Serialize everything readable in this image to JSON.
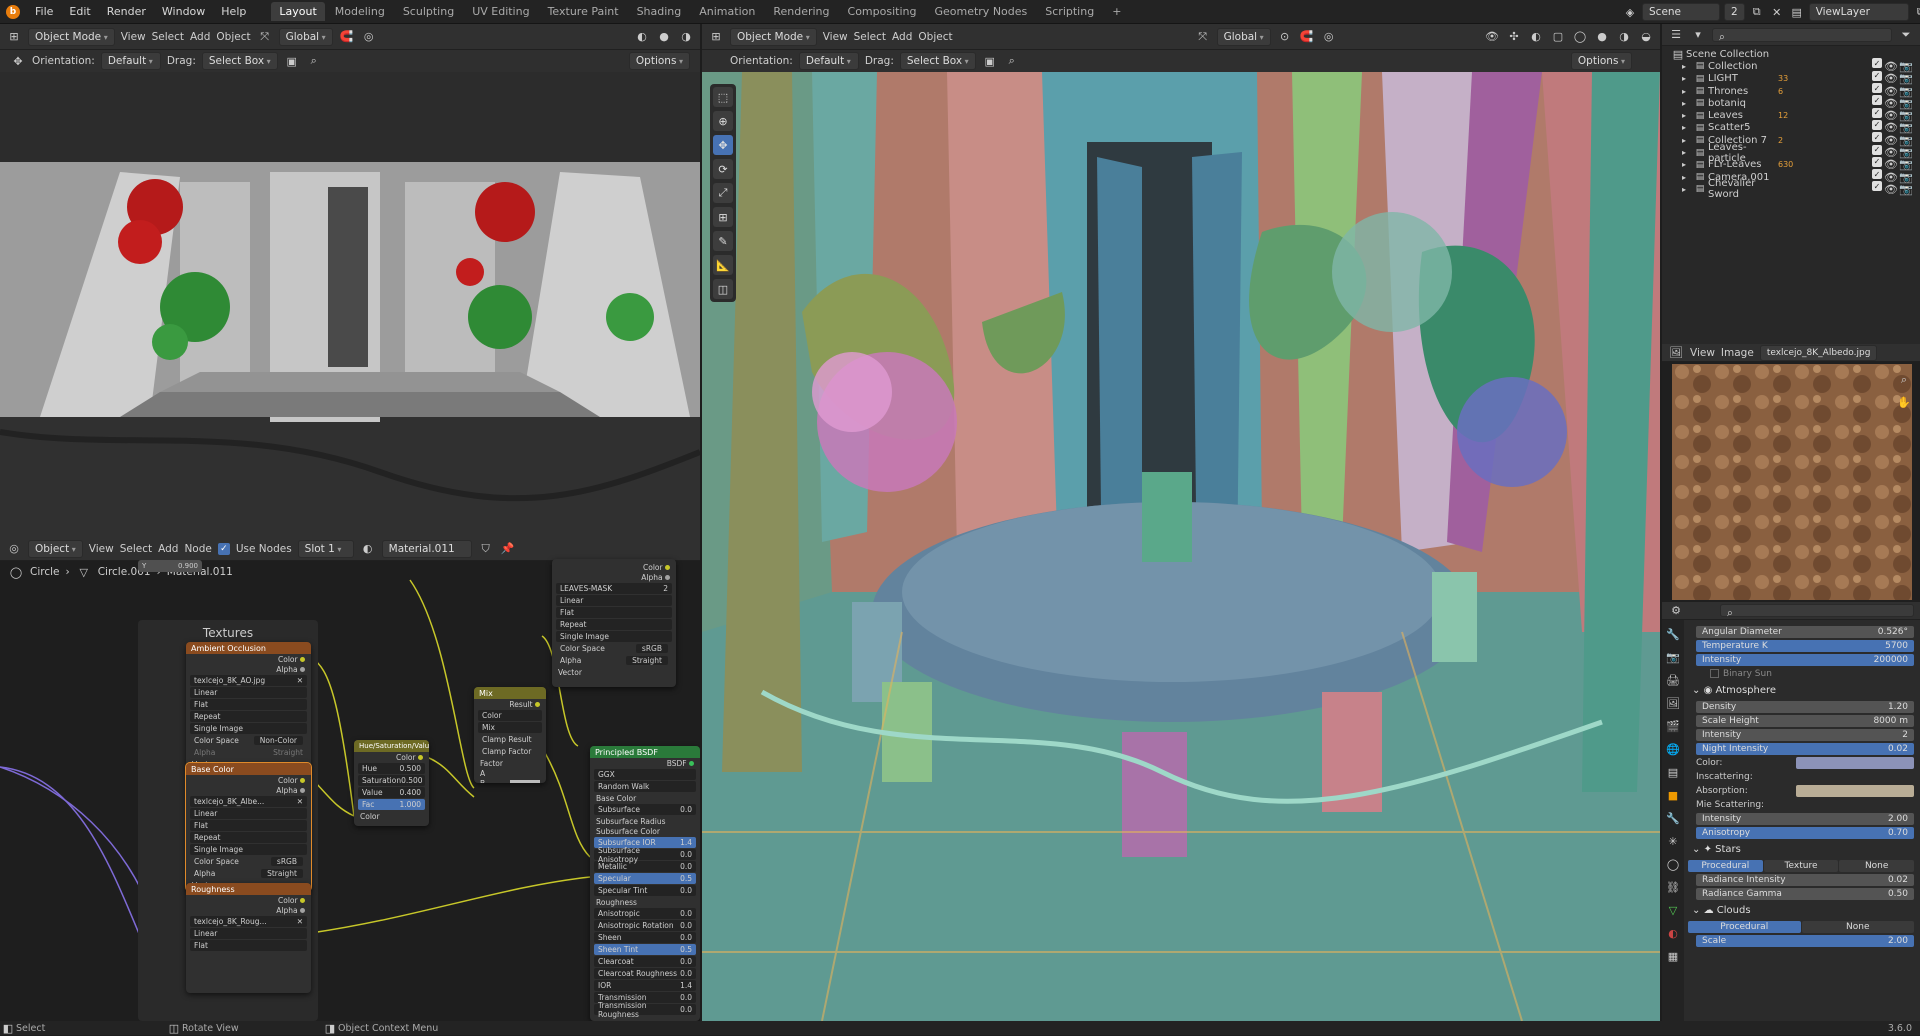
{
  "topbar": {
    "menus": [
      "File",
      "Edit",
      "Render",
      "Window",
      "Help"
    ],
    "workspaces": [
      "Layout",
      "Modeling",
      "Sculpting",
      "UV Editing",
      "Texture Paint",
      "Shading",
      "Animation",
      "Rendering",
      "Compositing",
      "Geometry Nodes",
      "Scripting"
    ],
    "add_tab": "+",
    "scene": "Scene",
    "scene_users": "2",
    "view_layer": "ViewLayer"
  },
  "vp_left": {
    "mode": "Object Mode",
    "menus": [
      "View",
      "Select",
      "Add",
      "Object"
    ],
    "transform": "Global",
    "orientation_label": "Orientation:",
    "orientation": "Default",
    "drag_label": "Drag:",
    "drag": "Select Box",
    "options": "Options"
  },
  "vp_main": {
    "mode": "Object Mode",
    "menus": [
      "View",
      "Select",
      "Add",
      "Object"
    ],
    "transform": "Global",
    "orientation_label": "Orientation:",
    "orientation": "Default",
    "drag_label": "Drag:",
    "drag": "Select Box",
    "options": "Options"
  },
  "node_editor": {
    "context": "Object",
    "menus": [
      "View",
      "Select",
      "Add",
      "Node"
    ],
    "use_nodes": "Use Nodes",
    "slot": "Slot 1",
    "material": "Material.011",
    "breadcrumb": [
      "Circle",
      "Circle.001",
      "Material.011"
    ],
    "popup": {
      "y_label": "Y",
      "y_value": "0.900"
    },
    "frame_title": "Textures",
    "ao": {
      "title": "Ambient Occlusion",
      "out": [
        "Color",
        "Alpha"
      ],
      "image": "texlcejo_8K_AO.jpg",
      "interp": "Linear",
      "proj": "Flat",
      "ext": "Repeat",
      "source": "Single Image",
      "cs_label": "Color Space",
      "cs": "Non-Color",
      "alpha_label": "Alpha",
      "alpha": "Straight",
      "vector": "Vector"
    },
    "base": {
      "title": "Base Color",
      "out": [
        "Color",
        "Alpha"
      ],
      "image": "texlcejo_8K_Albe...",
      "interp": "Linear",
      "proj": "Flat",
      "ext": "Repeat",
      "source": "Single Image",
      "cs_label": "Color Space",
      "cs": "sRGB",
      "alpha_label": "Alpha",
      "alpha": "Straight",
      "vector": "Vector"
    },
    "rough": {
      "title": "Roughness",
      "out": [
        "Color",
        "Alpha"
      ],
      "image": "texlcejo_8K_Roug...",
      "interp": "Linear",
      "proj": "Flat"
    },
    "hsv": {
      "title": "Hue/Saturation/Value",
      "out": "Color",
      "fields": [
        [
          "Hue",
          "0.500"
        ],
        [
          "Saturation",
          "0.500"
        ],
        [
          "Value",
          "0.400"
        ],
        [
          "Fac",
          "1.000"
        ]
      ],
      "in": "Color"
    },
    "mix": {
      "title": "Mix",
      "out": "Result",
      "type": "Color",
      "blend": "Mix",
      "clamp_result": "Clamp Result",
      "clamp_factor": "Clamp Factor",
      "factor": "Factor",
      "a": "A",
      "b": "B"
    },
    "leaves": {
      "out": [
        "Color",
        "Alpha"
      ],
      "image": "LEAVES-MASK",
      "users": "2",
      "interp": "Linear",
      "proj": "Flat",
      "ext": "Repeat",
      "source": "Single Image",
      "cs_label": "Color Space",
      "cs": "sRGB",
      "alpha_label": "Alpha",
      "alpha": "Straight",
      "vector": "Vector"
    },
    "bsdf": {
      "title": "Principled BSDF",
      "out": "BSDF",
      "dist": "GGX",
      "sss": "Random Walk",
      "rows": [
        [
          "Base Color",
          ""
        ],
        [
          "Subsurface",
          "0.0"
        ],
        [
          "Subsurface Radius",
          ""
        ],
        [
          "Subsurface Color",
          ""
        ],
        [
          "Subsurface IOR",
          "1.4"
        ],
        [
          "Subsurface Anisotropy",
          "0.0"
        ],
        [
          "Metallic",
          "0.0"
        ],
        [
          "Specular",
          "0.5"
        ],
        [
          "Specular Tint",
          "0.0"
        ],
        [
          "Roughness",
          ""
        ],
        [
          "Anisotropic",
          "0.0"
        ],
        [
          "Anisotropic Rotation",
          "0.0"
        ],
        [
          "Sheen",
          "0.0"
        ],
        [
          "Sheen Tint",
          "0.5"
        ],
        [
          "Clearcoat",
          "0.0"
        ],
        [
          "Clearcoat Roughness",
          "0.0"
        ],
        [
          "IOR",
          "1.4"
        ],
        [
          "Transmission",
          "0.0"
        ],
        [
          "Transmission Roughness",
          "0.0"
        ]
      ]
    }
  },
  "outliner": {
    "root": "Scene Collection",
    "items": [
      "Collection",
      "LIGHT",
      "Thrones",
      "botaniq",
      "Leaves",
      "Scatter5",
      "Collection 7",
      "Leaves-particle",
      "FLY-Leaves",
      "Camera.001",
      "Chevalier Sword"
    ],
    "badges": [
      "",
      "33",
      "6",
      "",
      "12",
      "",
      "2",
      "",
      "630",
      "",
      ""
    ]
  },
  "image_editor": {
    "menus": [
      "View",
      "Image"
    ],
    "image": "texlcejo_8K_Albedo.jpg"
  },
  "properties": {
    "sun": [
      [
        "Angular Diameter",
        "0.526°"
      ],
      [
        "Temperature K",
        "5700"
      ],
      [
        "Intensity",
        "200000"
      ]
    ],
    "binary_sun": "Binary Sun",
    "atmosphere": "Atmosphere",
    "atmo_fields": [
      [
        "Density",
        "1.20"
      ],
      [
        "Scale Height",
        "8000 m"
      ],
      [
        "Intensity",
        "2"
      ],
      [
        "Night Intensity",
        "0.02"
      ]
    ],
    "color_label": "Color:",
    "inscattering": "Inscattering:",
    "absorption": "Absorption:",
    "mie": "Mie Scattering:",
    "mie_fields": [
      [
        "Intensity",
        "2.00"
      ],
      [
        "Anisotropy",
        "0.70"
      ]
    ],
    "stars": "Stars",
    "star_modes": [
      "Procedural",
      "Texture",
      "None"
    ],
    "star_fields": [
      [
        "Radiance Intensity",
        "0.02"
      ],
      [
        "Radiance Gamma",
        "0.50"
      ]
    ],
    "clouds": "Clouds",
    "cloud_modes": [
      "Procedural",
      "None"
    ],
    "cloud_fields": [
      [
        "Scale",
        "2.00"
      ]
    ],
    "colors": {
      "sky": "#8c93b8",
      "absorb": "#b9ad96"
    }
  },
  "status": {
    "left": "Select",
    "mid": "Rotate View",
    "ctx": "Object Context Menu",
    "version": "3.6.0"
  }
}
